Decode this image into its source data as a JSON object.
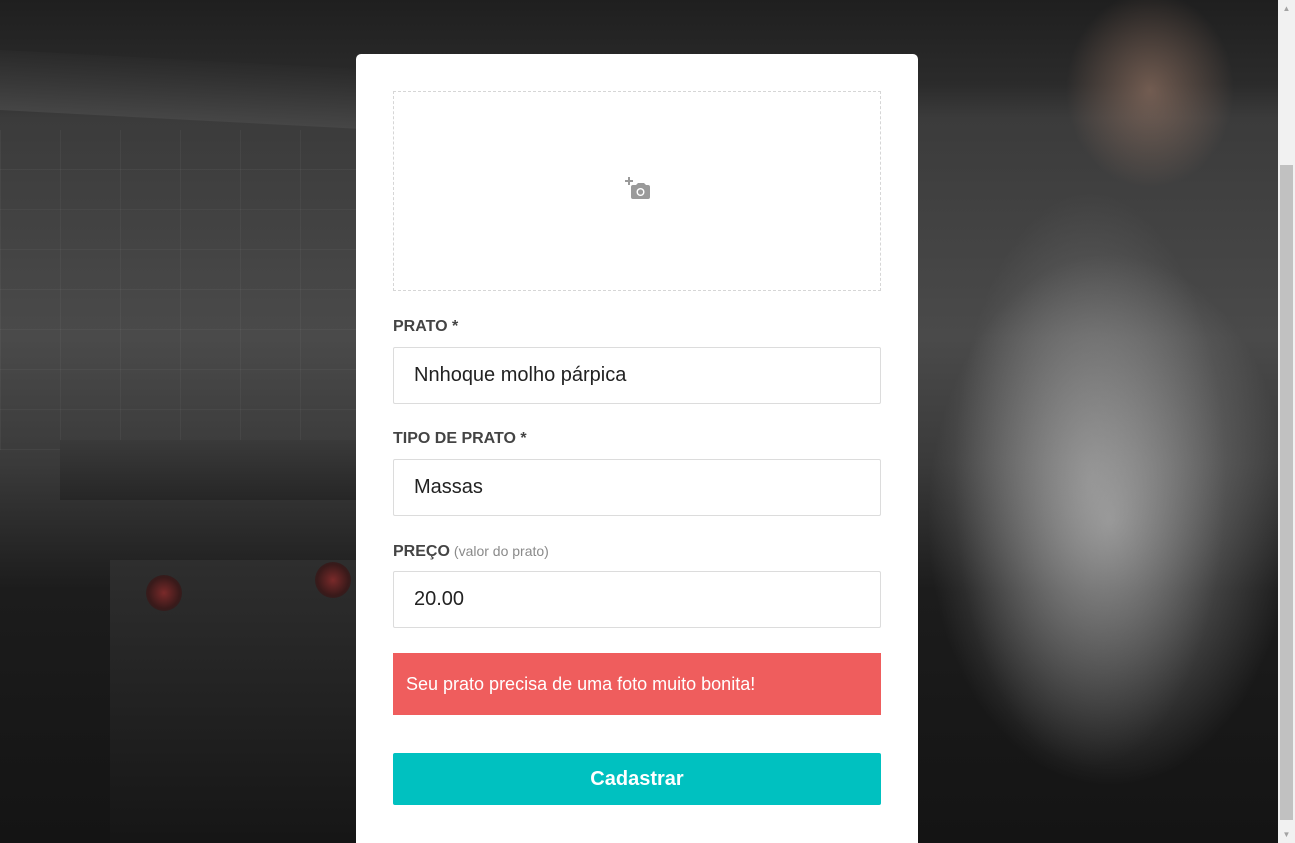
{
  "form": {
    "photo_icon": "add-a-photo-icon",
    "dish": {
      "label": "PRATO *",
      "value": "Nnhoque molho párpica"
    },
    "dish_type": {
      "label": "TIPO DE PRATO *",
      "value": "Massas"
    },
    "price": {
      "label": "PREÇO",
      "hint": "(valor do prato)",
      "value": "20.00"
    },
    "error_message": "Seu prato precisa de uma foto muito bonita!",
    "submit_label": "Cadastrar"
  },
  "colors": {
    "accent": "#00c1c0",
    "error": "#ef5d5d",
    "label": "#444444"
  }
}
